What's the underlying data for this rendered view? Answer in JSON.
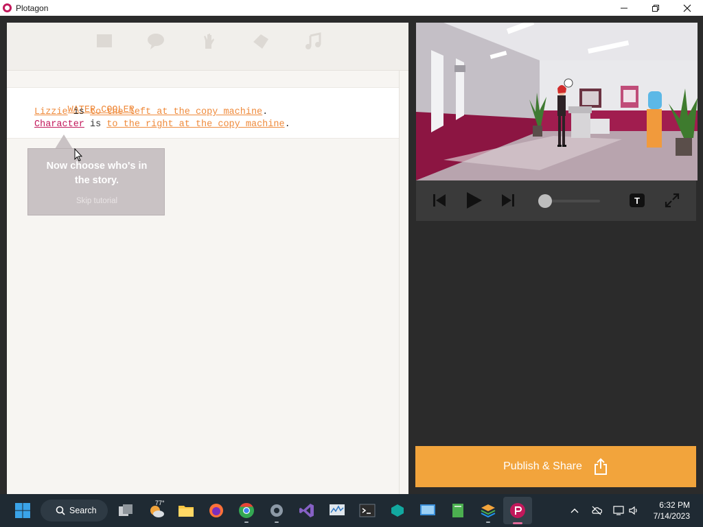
{
  "window": {
    "title": "Plotagon",
    "controls": [
      "minimize",
      "restore",
      "close"
    ]
  },
  "toolbar": {
    "icons": [
      "scene-icon",
      "dialogue-icon",
      "action-icon",
      "sound-effect-icon",
      "music-icon"
    ]
  },
  "script": {
    "scene": "WATER COOLER",
    "lines": [
      {
        "name": "Lizzie",
        "verb": " is ",
        "position": "to the left at the copy machine",
        "end": "."
      },
      {
        "name": "Character",
        "verb": " is ",
        "position": "to the right at the copy machine",
        "end": "."
      }
    ]
  },
  "tutorial": {
    "message": "Now choose who's in the story.",
    "skip": "Skip tutorial"
  },
  "player": {
    "buttons": [
      "previous",
      "play",
      "next",
      "subtitles",
      "fullscreen"
    ],
    "subtitles_label": "T",
    "progress": 0
  },
  "publish": {
    "label": "Publish & Share"
  },
  "taskbar": {
    "search_label": "Search",
    "weather_temp": "77°",
    "time": "6:32 PM",
    "date": "7/14/2023"
  },
  "colors": {
    "accent": "#f2a43c",
    "brand": "#c2185b",
    "link": "#ef8a3b"
  }
}
